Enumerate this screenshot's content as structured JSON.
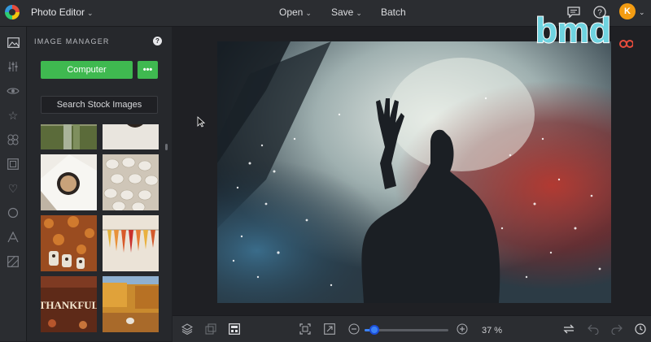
{
  "app": {
    "title": "Photo Editor"
  },
  "top_menu": {
    "open": "Open",
    "save": "Save",
    "batch": "Batch"
  },
  "user": {
    "initial": "K"
  },
  "panel": {
    "title": "IMAGE MANAGER",
    "computer_label": "Computer",
    "more_label": "•••",
    "stock_label": "Search Stock Images"
  },
  "thumbnails": [
    {
      "name": "thumb-plant-cactus",
      "colors": [
        "#6b7a4a",
        "#a8b28a"
      ]
    },
    {
      "name": "thumb-coffee-top",
      "colors": [
        "#e8e4dc",
        "#c9c2b6"
      ]
    },
    {
      "name": "thumb-coffee-cup",
      "colors": [
        "#f2f0ec",
        "#3a3029"
      ]
    },
    {
      "name": "thumb-stones",
      "colors": [
        "#d8d2c8",
        "#b8b0a2"
      ]
    },
    {
      "name": "thumb-autumn-leaves",
      "colors": [
        "#b65d2a",
        "#7a3b18"
      ]
    },
    {
      "name": "thumb-colored-leaves",
      "colors": [
        "#e7d6c2",
        "#e39b2c"
      ]
    },
    {
      "name": "thumb-thankful",
      "colors": [
        "#6b2f1b",
        "#9e4a2c"
      ]
    },
    {
      "name": "thumb-autumn-park",
      "colors": [
        "#c98e3c",
        "#5e7f3a"
      ]
    }
  ],
  "watermark": {
    "text": "bmd"
  },
  "zoom": {
    "percent_label": "37 %",
    "value": 0.12
  },
  "colors": {
    "accent_green": "#3fb950",
    "accent_blue": "#3b82f6",
    "avatar": "#f39c12"
  }
}
